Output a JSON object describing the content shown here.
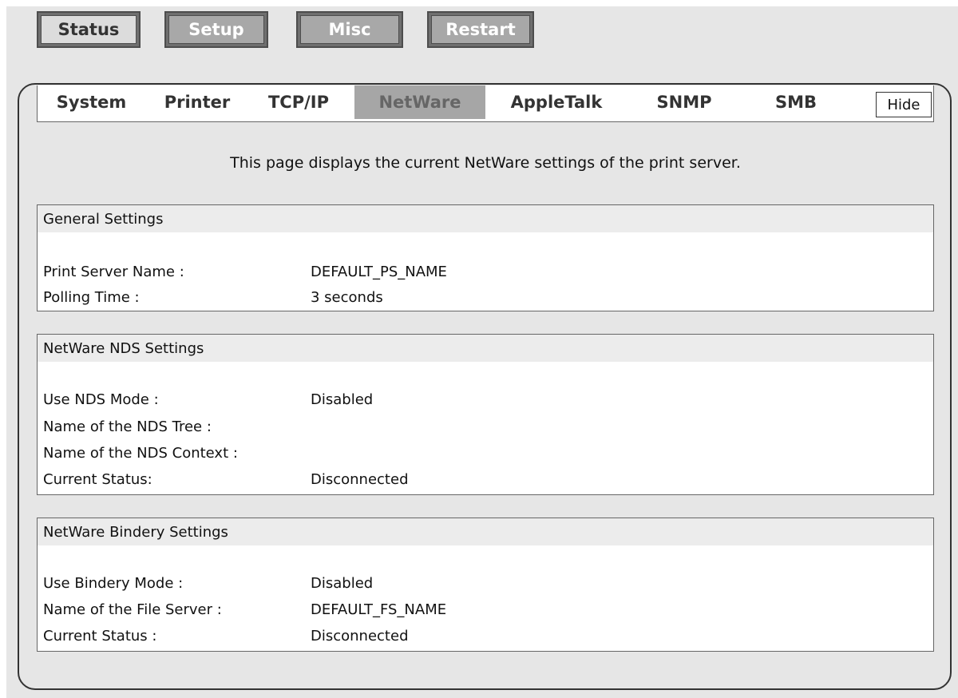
{
  "top_buttons": [
    {
      "label": "Status",
      "active": true
    },
    {
      "label": "Setup",
      "active": false
    },
    {
      "label": "Misc",
      "active": false
    },
    {
      "label": "Restart",
      "active": false
    }
  ],
  "tabs": [
    {
      "label": "System",
      "active": false
    },
    {
      "label": "Printer",
      "active": false
    },
    {
      "label": "TCP/IP",
      "active": false
    },
    {
      "label": "NetWare",
      "active": true
    },
    {
      "label": "AppleTalk",
      "active": false
    },
    {
      "label": "SNMP",
      "active": false
    },
    {
      "label": "SMB",
      "active": false
    }
  ],
  "hide_label": "Hide",
  "description": "This page displays the current NetWare settings of the print server.",
  "general": {
    "title": "General Settings",
    "rows": [
      {
        "label": "Print Server Name :",
        "value": "DEFAULT_PS_NAME"
      },
      {
        "label": "Polling Time :",
        "value": "3  seconds"
      }
    ]
  },
  "nds": {
    "title": "NetWare NDS Settings",
    "rows": [
      {
        "label": "Use NDS Mode :",
        "value": "Disabled"
      },
      {
        "label": "Name of the NDS Tree :",
        "value": ""
      },
      {
        "label": "Name of the NDS Context :",
        "value": ""
      },
      {
        "label": "Current Status:",
        "value": "Disconnected"
      }
    ]
  },
  "bindery": {
    "title": "NetWare Bindery Settings",
    "rows": [
      {
        "label": "Use Bindery Mode :",
        "value": "Disabled"
      },
      {
        "label": "Name of the File Server :",
        "value": "DEFAULT_FS_NAME"
      },
      {
        "label": "Current Status :",
        "value": "Disconnected"
      }
    ]
  }
}
